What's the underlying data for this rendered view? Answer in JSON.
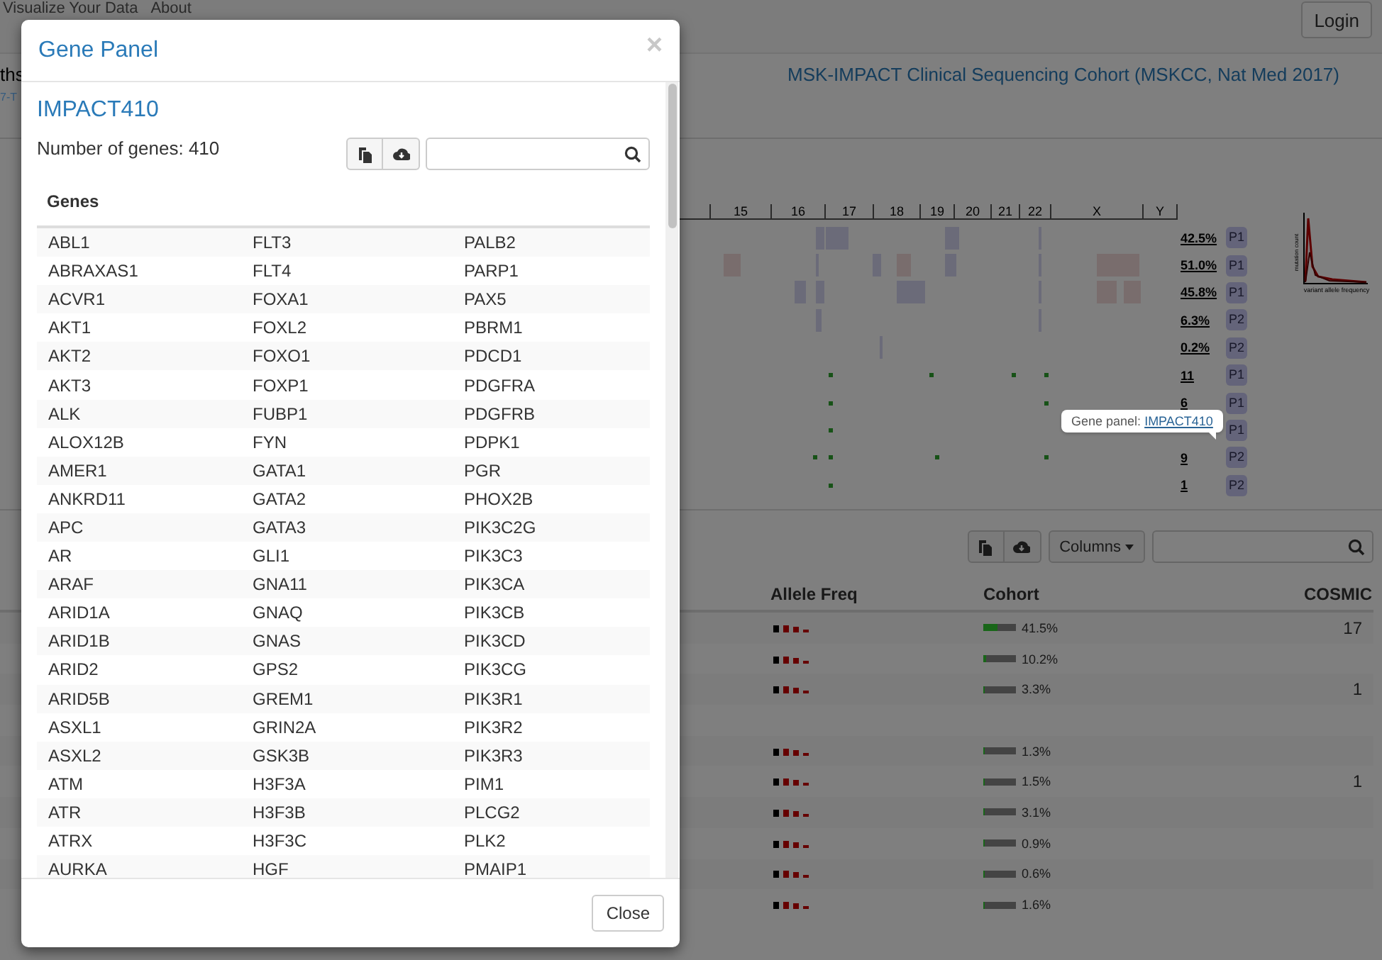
{
  "nav": {
    "links": [
      "Visualize Your Data",
      "About"
    ],
    "login": "Login"
  },
  "header": {
    "left_text": "ths",
    "left_tag": "7-T",
    "study": "MSK-IMPACT Clinical Sequencing Cohort (MSKCC, Nat Med 2017)"
  },
  "genome_panel": {
    "axis_labels": [
      "15",
      "16",
      "17",
      "18",
      "19",
      "20",
      "21",
      "22",
      "X",
      "Y"
    ],
    "tracks": [
      {
        "kind": "cna",
        "value": "42.5%",
        "panel": "P1"
      },
      {
        "kind": "cna",
        "value": "51.0%",
        "panel": "P1"
      },
      {
        "kind": "cna",
        "value": "45.8%",
        "panel": "P1"
      },
      {
        "kind": "cna",
        "value": "6.3%",
        "panel": "P2"
      },
      {
        "kind": "cna",
        "value": "0.2%",
        "panel": "P2"
      },
      {
        "kind": "mutation",
        "value": "11",
        "panel": "P1"
      },
      {
        "kind": "mutation",
        "value": "6",
        "panel": "P1"
      },
      {
        "kind": "mutation",
        "panel": "P1"
      },
      {
        "kind": "mutation",
        "value": "9",
        "panel": "P2"
      },
      {
        "kind": "mutation",
        "value": "1",
        "panel": "P2"
      }
    ],
    "histogram": {
      "ylabel": "mutation count",
      "xlabel": "variant allele frequency"
    },
    "tooltip": {
      "label": "Gene panel:",
      "link": "IMPACT410"
    }
  },
  "mutation_table": {
    "columns_button": "Columns",
    "columns": [
      "Allele Freq",
      "Cohort",
      "COSMIC"
    ],
    "rows": [
      {
        "cohort": "41.5%",
        "level": 0.415,
        "cosmic": "17"
      },
      {
        "cohort": "10.2%",
        "level": 0.102
      },
      {
        "cohort": "3.3%",
        "level": 0.033,
        "cosmic": "1"
      },
      {},
      {
        "cohort": "1.3%",
        "level": 0.013
      },
      {
        "cohort": "1.5%",
        "level": 0.015,
        "cosmic": "1"
      },
      {
        "cohort": "3.1%",
        "level": 0.031
      },
      {
        "cohort": "0.9%",
        "level": 0.009
      },
      {
        "cohort": "0.6%",
        "level": 0.006
      },
      {
        "cohort": "1.6%",
        "level": 0.016
      }
    ]
  },
  "modal": {
    "title": "Gene Panel",
    "close_icon": "×",
    "panel_name": "IMPACT410",
    "gene_count": "Number of genes: 410",
    "table_header": "Genes",
    "rows": [
      [
        "ABL1",
        "FLT3",
        "PALB2"
      ],
      [
        "ABRAXAS1",
        "FLT4",
        "PARP1"
      ],
      [
        "ACVR1",
        "FOXA1",
        "PAX5"
      ],
      [
        "AKT1",
        "FOXL2",
        "PBRM1"
      ],
      [
        "AKT2",
        "FOXO1",
        "PDCD1"
      ],
      [
        "AKT3",
        "FOXP1",
        "PDGFRA"
      ],
      [
        "ALK",
        "FUBP1",
        "PDGFRB"
      ],
      [
        "ALOX12B",
        "FYN",
        "PDPK1"
      ],
      [
        "AMER1",
        "GATA1",
        "PGR"
      ],
      [
        "ANKRD11",
        "GATA2",
        "PHOX2B"
      ],
      [
        "APC",
        "GATA3",
        "PIK3C2G"
      ],
      [
        "AR",
        "GLI1",
        "PIK3C3"
      ],
      [
        "ARAF",
        "GNA11",
        "PIK3CA"
      ],
      [
        "ARID1A",
        "GNAQ",
        "PIK3CB"
      ],
      [
        "ARID1B",
        "GNAS",
        "PIK3CD"
      ],
      [
        "ARID2",
        "GPS2",
        "PIK3CG"
      ],
      [
        "ARID5B",
        "GREM1",
        "PIK3R1"
      ],
      [
        "ASXL1",
        "GRIN2A",
        "PIK3R2"
      ],
      [
        "ASXL2",
        "GSK3B",
        "PIK3R3"
      ],
      [
        "ATM",
        "H3F3A",
        "PIM1"
      ],
      [
        "ATR",
        "H3F3B",
        "PLCG2"
      ],
      [
        "ATRX",
        "H3F3C",
        "PLK2"
      ],
      [
        "AURKA",
        "HGF",
        "PMAIP1"
      ]
    ],
    "close_button": "Close"
  }
}
